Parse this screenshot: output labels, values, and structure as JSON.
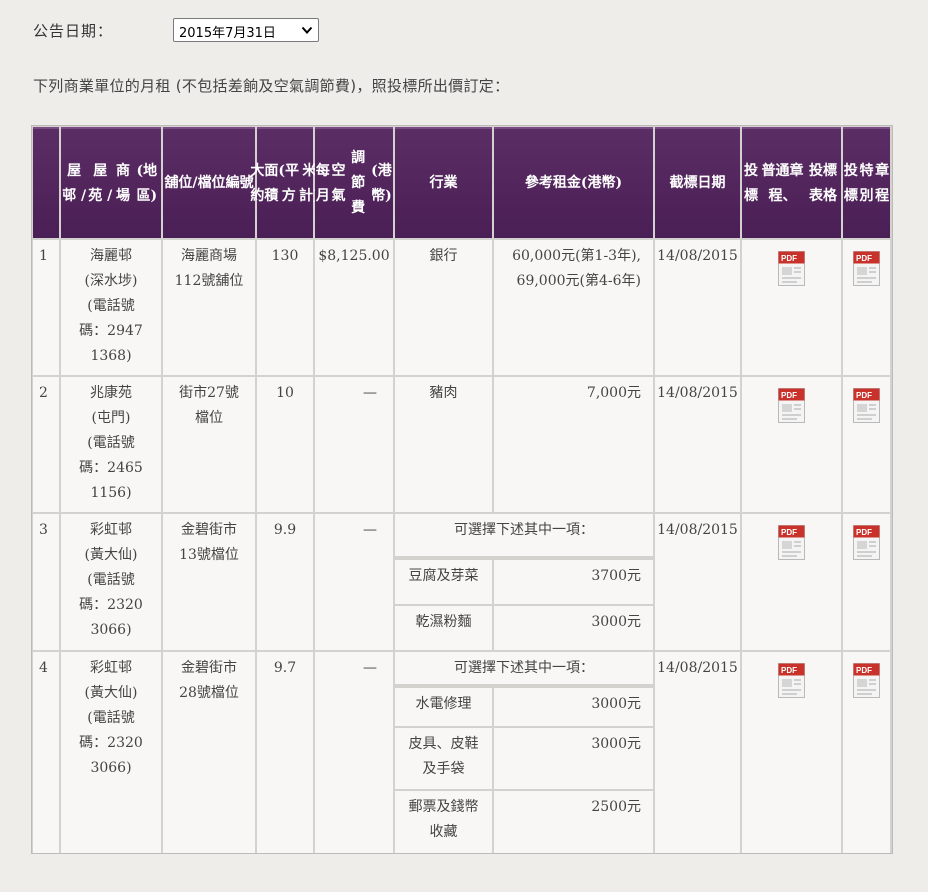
{
  "date_label": "公告日期：",
  "date_selected": "2015年7月31日",
  "intro_text": "下列商業單位的月租 (不包括差餉及空氣調節費)，照投標所出價訂定：",
  "pdf_label": "PDF",
  "headers": {
    "estate": "屋邨 / 屋苑 / 商場 (地區)",
    "unit": "舖位/ 檔位 編號",
    "area": "大約 面積 (平方 米計)",
    "ac": "每月 空氣 調節費 (港幣)",
    "trade": "行業",
    "rent": "參考 租金 (港幣)",
    "closing": "截標 日期",
    "general": "投標 普通章程、 投標表格",
    "special": "投標 特別 章程"
  },
  "rows": [
    {
      "no": "1",
      "estate": "海麗邨 (深水埗) (電話號 碼：2947 1368)",
      "unit": "海麗商場 112號舖位",
      "area": "130",
      "ac": "$8,125.00",
      "trade": "銀行",
      "rent": "60,000元(第1-3年), 69,000元(第4-6年)",
      "closing": "14/08/2015"
    },
    {
      "no": "2",
      "estate": "兆康苑 (屯門) (電話號 碼：2465 1156)",
      "unit": "街市27號 檔位",
      "area": "10",
      "ac": "—",
      "trade": "豬肉",
      "rent": "7,000元",
      "closing": "14/08/2015"
    },
    {
      "no": "3",
      "estate": "彩虹邨 (黃大仙) (電話號 碼：2320 3066)",
      "unit": "金碧街市 13號檔位",
      "area": "9.9",
      "ac": "—",
      "choice": "可選擇下述其中一項：",
      "options": [
        {
          "trade": "豆腐及芽菜",
          "rent": "3700元"
        },
        {
          "trade": "乾濕粉麵",
          "rent": "3000元"
        }
      ],
      "closing": "14/08/2015"
    },
    {
      "no": "4",
      "estate": "彩虹邨 (黃大仙) (電話號 碼：2320 3066)",
      "unit": "金碧街市 28號檔位",
      "area": "9.7",
      "ac": "—",
      "choice": "可選擇下述其中一項：",
      "options": [
        {
          "trade": "水電修理",
          "rent": "3000元"
        },
        {
          "trade": "皮具、皮鞋 及手袋",
          "rent": "3000元"
        },
        {
          "trade": "郵票及錢幣 收藏",
          "rent": "2500元"
        }
      ],
      "closing": "14/08/2015"
    }
  ],
  "colors": {
    "header_bg": "#4e2259",
    "cell_bg": "#f8f7f5",
    "grid": "#d4d2cf",
    "pdf_red": "#c8322a"
  }
}
